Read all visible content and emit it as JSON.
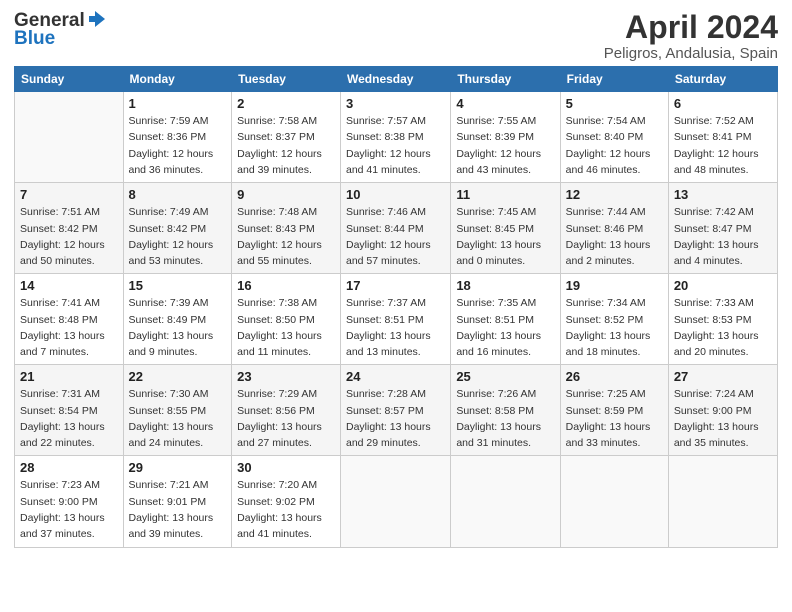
{
  "header": {
    "logo_line1": "General",
    "logo_line2": "Blue",
    "month_title": "April 2024",
    "location": "Peligros, Andalusia, Spain"
  },
  "days_of_week": [
    "Sunday",
    "Monday",
    "Tuesday",
    "Wednesday",
    "Thursday",
    "Friday",
    "Saturday"
  ],
  "weeks": [
    [
      {
        "day": "",
        "info": ""
      },
      {
        "day": "1",
        "info": "Sunrise: 7:59 AM\nSunset: 8:36 PM\nDaylight: 12 hours\nand 36 minutes."
      },
      {
        "day": "2",
        "info": "Sunrise: 7:58 AM\nSunset: 8:37 PM\nDaylight: 12 hours\nand 39 minutes."
      },
      {
        "day": "3",
        "info": "Sunrise: 7:57 AM\nSunset: 8:38 PM\nDaylight: 12 hours\nand 41 minutes."
      },
      {
        "day": "4",
        "info": "Sunrise: 7:55 AM\nSunset: 8:39 PM\nDaylight: 12 hours\nand 43 minutes."
      },
      {
        "day": "5",
        "info": "Sunrise: 7:54 AM\nSunset: 8:40 PM\nDaylight: 12 hours\nand 46 minutes."
      },
      {
        "day": "6",
        "info": "Sunrise: 7:52 AM\nSunset: 8:41 PM\nDaylight: 12 hours\nand 48 minutes."
      }
    ],
    [
      {
        "day": "7",
        "info": "Sunrise: 7:51 AM\nSunset: 8:42 PM\nDaylight: 12 hours\nand 50 minutes."
      },
      {
        "day": "8",
        "info": "Sunrise: 7:49 AM\nSunset: 8:42 PM\nDaylight: 12 hours\nand 53 minutes."
      },
      {
        "day": "9",
        "info": "Sunrise: 7:48 AM\nSunset: 8:43 PM\nDaylight: 12 hours\nand 55 minutes."
      },
      {
        "day": "10",
        "info": "Sunrise: 7:46 AM\nSunset: 8:44 PM\nDaylight: 12 hours\nand 57 minutes."
      },
      {
        "day": "11",
        "info": "Sunrise: 7:45 AM\nSunset: 8:45 PM\nDaylight: 13 hours\nand 0 minutes."
      },
      {
        "day": "12",
        "info": "Sunrise: 7:44 AM\nSunset: 8:46 PM\nDaylight: 13 hours\nand 2 minutes."
      },
      {
        "day": "13",
        "info": "Sunrise: 7:42 AM\nSunset: 8:47 PM\nDaylight: 13 hours\nand 4 minutes."
      }
    ],
    [
      {
        "day": "14",
        "info": "Sunrise: 7:41 AM\nSunset: 8:48 PM\nDaylight: 13 hours\nand 7 minutes."
      },
      {
        "day": "15",
        "info": "Sunrise: 7:39 AM\nSunset: 8:49 PM\nDaylight: 13 hours\nand 9 minutes."
      },
      {
        "day": "16",
        "info": "Sunrise: 7:38 AM\nSunset: 8:50 PM\nDaylight: 13 hours\nand 11 minutes."
      },
      {
        "day": "17",
        "info": "Sunrise: 7:37 AM\nSunset: 8:51 PM\nDaylight: 13 hours\nand 13 minutes."
      },
      {
        "day": "18",
        "info": "Sunrise: 7:35 AM\nSunset: 8:51 PM\nDaylight: 13 hours\nand 16 minutes."
      },
      {
        "day": "19",
        "info": "Sunrise: 7:34 AM\nSunset: 8:52 PM\nDaylight: 13 hours\nand 18 minutes."
      },
      {
        "day": "20",
        "info": "Sunrise: 7:33 AM\nSunset: 8:53 PM\nDaylight: 13 hours\nand 20 minutes."
      }
    ],
    [
      {
        "day": "21",
        "info": "Sunrise: 7:31 AM\nSunset: 8:54 PM\nDaylight: 13 hours\nand 22 minutes."
      },
      {
        "day": "22",
        "info": "Sunrise: 7:30 AM\nSunset: 8:55 PM\nDaylight: 13 hours\nand 24 minutes."
      },
      {
        "day": "23",
        "info": "Sunrise: 7:29 AM\nSunset: 8:56 PM\nDaylight: 13 hours\nand 27 minutes."
      },
      {
        "day": "24",
        "info": "Sunrise: 7:28 AM\nSunset: 8:57 PM\nDaylight: 13 hours\nand 29 minutes."
      },
      {
        "day": "25",
        "info": "Sunrise: 7:26 AM\nSunset: 8:58 PM\nDaylight: 13 hours\nand 31 minutes."
      },
      {
        "day": "26",
        "info": "Sunrise: 7:25 AM\nSunset: 8:59 PM\nDaylight: 13 hours\nand 33 minutes."
      },
      {
        "day": "27",
        "info": "Sunrise: 7:24 AM\nSunset: 9:00 PM\nDaylight: 13 hours\nand 35 minutes."
      }
    ],
    [
      {
        "day": "28",
        "info": "Sunrise: 7:23 AM\nSunset: 9:00 PM\nDaylight: 13 hours\nand 37 minutes."
      },
      {
        "day": "29",
        "info": "Sunrise: 7:21 AM\nSunset: 9:01 PM\nDaylight: 13 hours\nand 39 minutes."
      },
      {
        "day": "30",
        "info": "Sunrise: 7:20 AM\nSunset: 9:02 PM\nDaylight: 13 hours\nand 41 minutes."
      },
      {
        "day": "",
        "info": ""
      },
      {
        "day": "",
        "info": ""
      },
      {
        "day": "",
        "info": ""
      },
      {
        "day": "",
        "info": ""
      }
    ]
  ]
}
